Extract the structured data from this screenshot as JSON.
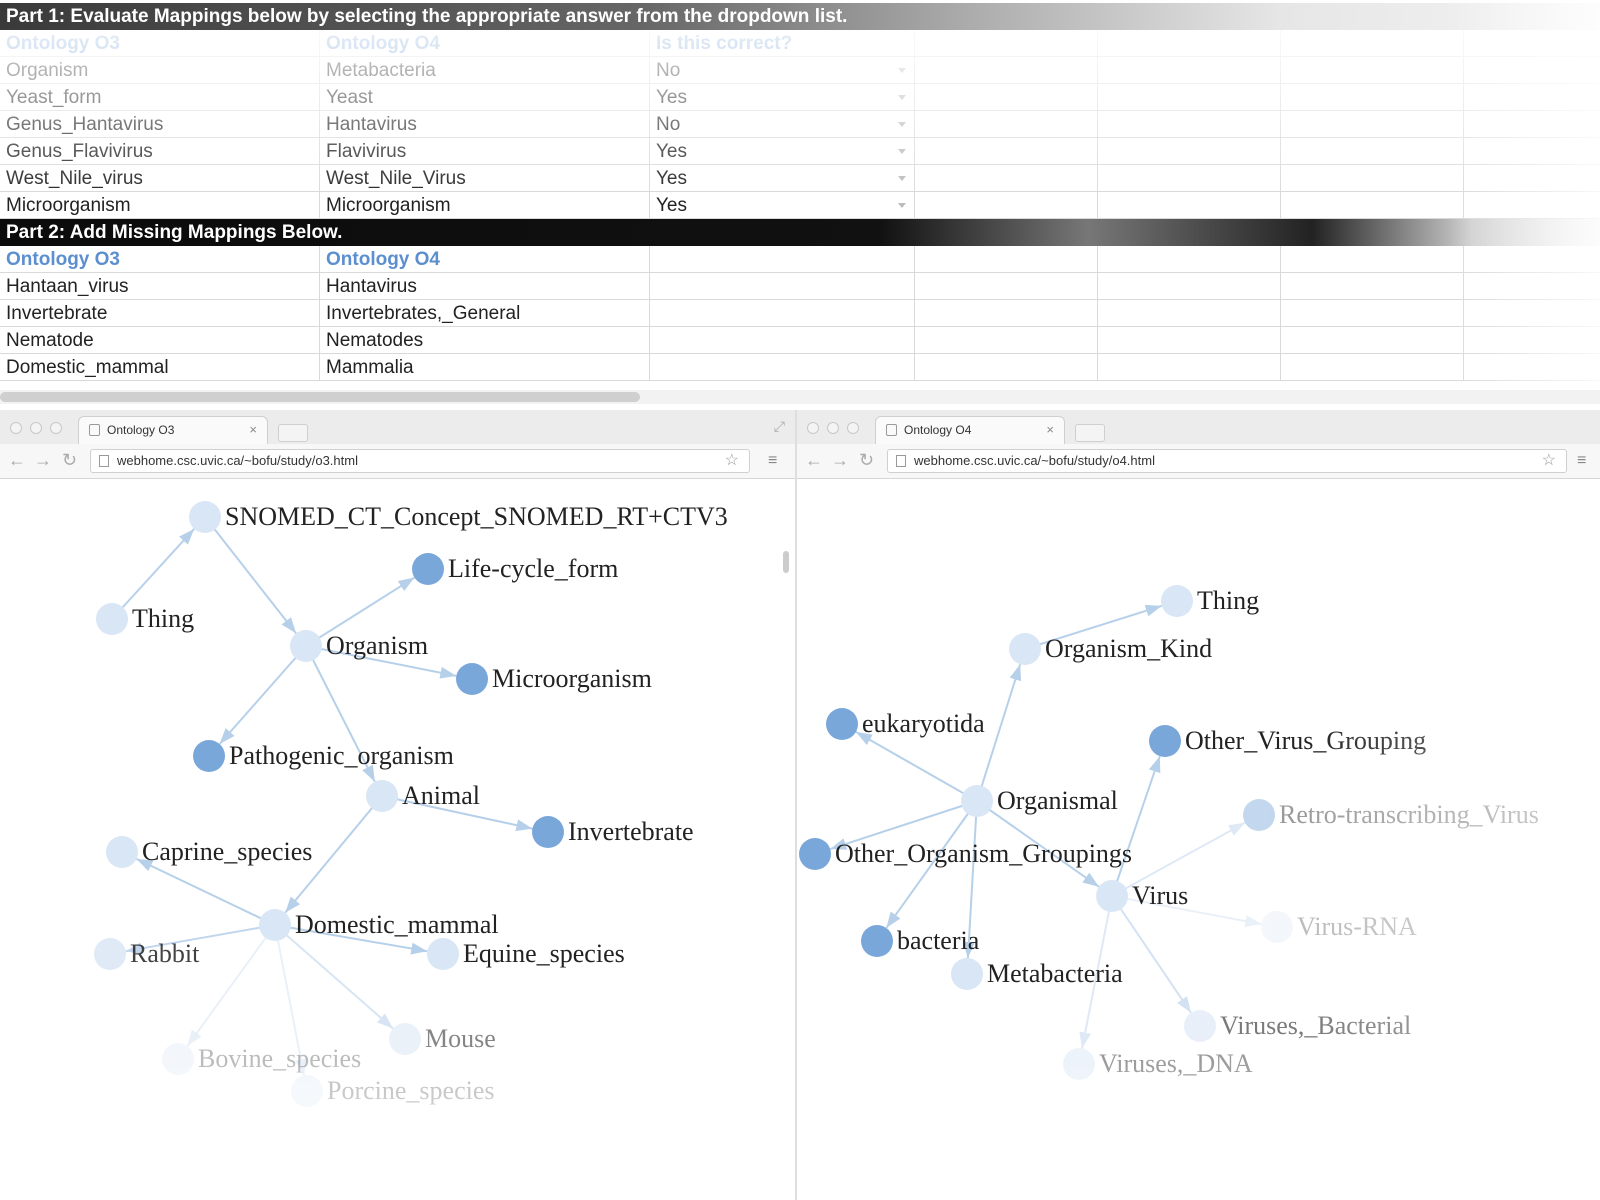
{
  "sheet": {
    "part1_header": "Part 1: Evaluate Mappings below by selecting the appropriate answer from the dropdown list.",
    "part1_columns": [
      "Ontology O3",
      "Ontology O4",
      "Is this correct?"
    ],
    "part1_rows": [
      {
        "o3": "Organism",
        "o4": "Metabacteria",
        "answer": "No"
      },
      {
        "o3": "Yeast_form",
        "o4": "Yeast",
        "answer": "Yes"
      },
      {
        "o3": "Genus_Hantavirus",
        "o4": "Hantavirus",
        "answer": "No"
      },
      {
        "o3": "Genus_Flavivirus",
        "o4": "Flavivirus",
        "answer": "Yes"
      },
      {
        "o3": "West_Nile_virus",
        "o4": "West_Nile_Virus",
        "answer": "Yes"
      },
      {
        "o3": "Microorganism",
        "o4": "Microorganism",
        "answer": "Yes"
      }
    ],
    "part2_header": "Part 2: Add Missing Mappings Below.",
    "part2_columns": [
      "Ontology O3",
      "Ontology O4"
    ],
    "part2_rows": [
      {
        "o3": "Hantaan_virus",
        "o4": "Hantavirus"
      },
      {
        "o3": "Invertebrate",
        "o4": "Invertebrates,_General"
      },
      {
        "o3": "Nematode",
        "o4": "Nematodes"
      },
      {
        "o3": "Domestic_mammal",
        "o4": "Mammalia"
      }
    ]
  },
  "browser_left": {
    "tab_title": "Ontology O3",
    "url": "webhome.csc.uvic.ca/~bofu/study/o3.html",
    "graph": {
      "nodes": [
        {
          "id": "snomed",
          "label": "SNOMED_CT_Concept_SNOMED_RT+CTV3",
          "expanded": false,
          "opacity": 1
        },
        {
          "id": "lifecycle",
          "label": "Life-cycle_form",
          "expanded": true,
          "opacity": 1
        },
        {
          "id": "thing",
          "label": "Thing",
          "expanded": false,
          "opacity": 1
        },
        {
          "id": "organism",
          "label": "Organism",
          "expanded": false,
          "opacity": 1
        },
        {
          "id": "microorganism",
          "label": "Microorganism",
          "expanded": true,
          "opacity": 1
        },
        {
          "id": "pathogenic",
          "label": "Pathogenic_organism",
          "expanded": true,
          "opacity": 1
        },
        {
          "id": "animal",
          "label": "Animal",
          "expanded": false,
          "opacity": 1
        },
        {
          "id": "invertebrate",
          "label": "Invertebrate",
          "expanded": true,
          "opacity": 1
        },
        {
          "id": "caprine",
          "label": "Caprine_species",
          "expanded": false,
          "opacity": 1
        },
        {
          "id": "domestic",
          "label": "Domestic_mammal",
          "expanded": false,
          "opacity": 1
        },
        {
          "id": "rabbit",
          "label": "Rabbit",
          "expanded": false,
          "opacity": 0.85
        },
        {
          "id": "equine",
          "label": "Equine_species",
          "expanded": false,
          "opacity": 1
        },
        {
          "id": "mouse",
          "label": "Mouse",
          "expanded": false,
          "opacity": 0.55
        },
        {
          "id": "bovine",
          "label": "Bovine_species",
          "expanded": false,
          "opacity": 0.3
        },
        {
          "id": "porcine",
          "label": "Porcine_species",
          "expanded": false,
          "opacity": 0.3
        }
      ],
      "edges": [
        [
          "thing",
          "snomed"
        ],
        [
          "snomed",
          "organism"
        ],
        [
          "organism",
          "lifecycle"
        ],
        [
          "organism",
          "microorganism"
        ],
        [
          "organism",
          "pathogenic"
        ],
        [
          "organism",
          "animal"
        ],
        [
          "animal",
          "invertebrate"
        ],
        [
          "animal",
          "domestic"
        ],
        [
          "domestic",
          "caprine"
        ],
        [
          "domestic",
          "rabbit"
        ],
        [
          "domestic",
          "equine"
        ],
        [
          "domestic",
          "mouse"
        ],
        [
          "domestic",
          "bovine"
        ],
        [
          "domestic",
          "porcine"
        ]
      ]
    }
  },
  "browser_right": {
    "tab_title": "Ontology O4",
    "url": "webhome.csc.uvic.ca/~bofu/study/o4.html",
    "graph": {
      "nodes": [
        {
          "id": "thing",
          "label": "Thing",
          "expanded": false,
          "opacity": 1
        },
        {
          "id": "orgkind",
          "label": "Organism_Kind",
          "expanded": false,
          "opacity": 1
        },
        {
          "id": "eukaryotida",
          "label": "eukaryotida",
          "expanded": true,
          "opacity": 1
        },
        {
          "id": "othervirus",
          "label": "Other_Virus_Grouping",
          "expanded": true,
          "opacity": 1
        },
        {
          "id": "organismal",
          "label": "Organismal",
          "expanded": false,
          "opacity": 1
        },
        {
          "id": "retro",
          "label": "Retro-transcribing_Virus",
          "expanded": true,
          "opacity": 0.45
        },
        {
          "id": "otherorg",
          "label": "Other_Organism_Groupings",
          "expanded": true,
          "opacity": 1
        },
        {
          "id": "virus",
          "label": "Virus",
          "expanded": false,
          "opacity": 1
        },
        {
          "id": "bacteria",
          "label": "bacteria",
          "expanded": true,
          "opacity": 1
        },
        {
          "id": "virusrna",
          "label": "Virus-RNA",
          "expanded": false,
          "opacity": 0.3
        },
        {
          "id": "metabacteria",
          "label": "Metabacteria",
          "expanded": false,
          "opacity": 1
        },
        {
          "id": "virbact",
          "label": "Viruses,_Bacterial",
          "expanded": false,
          "opacity": 0.6
        },
        {
          "id": "virdna",
          "label": "Viruses,_DNA",
          "expanded": false,
          "opacity": 0.45
        }
      ],
      "edges": [
        [
          "orgkind",
          "thing"
        ],
        [
          "organismal",
          "orgkind"
        ],
        [
          "organismal",
          "eukaryotida"
        ],
        [
          "organismal",
          "otherorg"
        ],
        [
          "organismal",
          "bacteria"
        ],
        [
          "organismal",
          "metabacteria"
        ],
        [
          "organismal",
          "virus"
        ],
        [
          "virus",
          "othervirus"
        ],
        [
          "virus",
          "retro"
        ],
        [
          "virus",
          "virusrna"
        ],
        [
          "virus",
          "virbact"
        ],
        [
          "virus",
          "virdna"
        ]
      ]
    }
  },
  "colors": {
    "node_collapsed": "#d9e6f5",
    "node_expanded": "#7aa7d9",
    "edge": "#b7d0ea",
    "header_blue": "#5b8fcf"
  }
}
